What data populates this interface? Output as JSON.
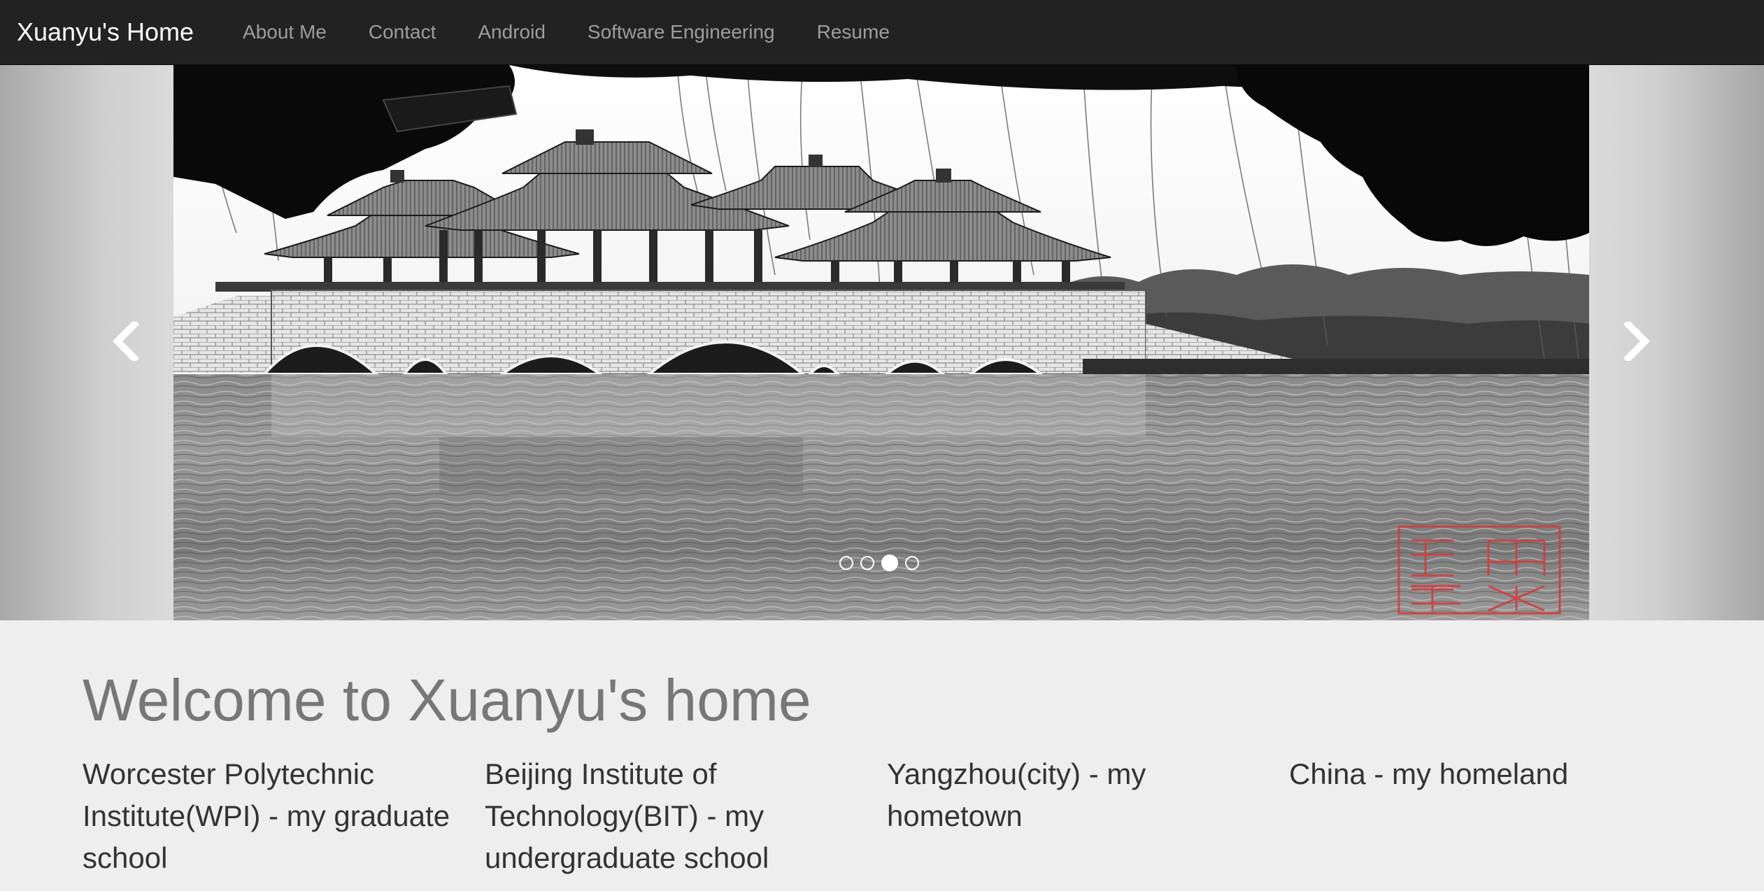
{
  "navbar": {
    "brand": "Xuanyu's Home",
    "links": [
      "About Me",
      "Contact",
      "Android",
      "Software Engineering",
      "Resume"
    ]
  },
  "carousel": {
    "slide_count": 4,
    "active_index": 2,
    "prev_icon": "chevron-left-icon",
    "next_icon": "chevron-right-icon",
    "image_description_icon": "photo-bridge-pavilions",
    "seal_color": "#d43a3a"
  },
  "main": {
    "heading": "Welcome to Xuanyu's home",
    "columns": [
      "Worcester Polytechnic Institute(WPI) - my graduate school",
      "Beijing Institute of Technology(BIT) - my undergraduate school",
      "Yangzhou(city) - my hometown",
      "China - my homeland"
    ]
  },
  "colors": {
    "navbar_bg": "#222222",
    "brand_text": "#ffffff",
    "nav_text": "#9d9d9d",
    "page_bg": "#eeeeee",
    "heading_text": "#777777",
    "body_text": "#333333"
  }
}
